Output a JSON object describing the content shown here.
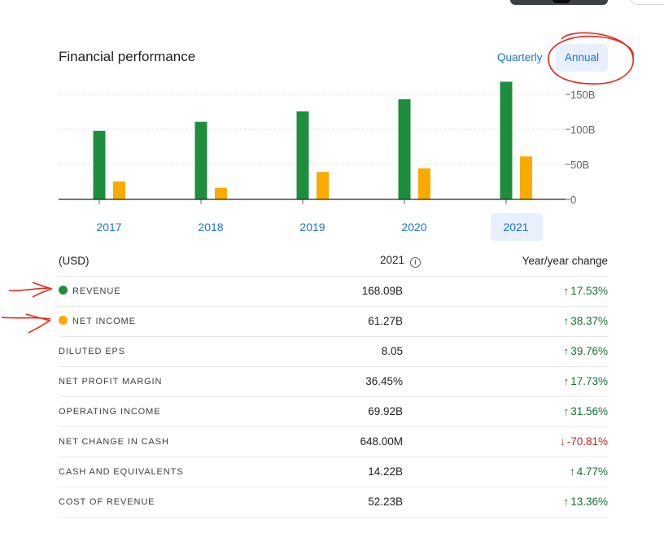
{
  "header": {
    "title": "Financial performance",
    "toggle_quarterly": "Quarterly",
    "toggle_annual": "Annual"
  },
  "colors": {
    "revenue": "#1e8e3e",
    "net_income": "#f9ab00",
    "accent": "#1a73e8",
    "positive": "#137333",
    "negative": "#c5221f"
  },
  "chart_data": {
    "type": "bar",
    "categories": [
      "2017",
      "2018",
      "2019",
      "2020",
      "2021"
    ],
    "series": [
      {
        "name": "Revenue",
        "values": [
          97.9,
          110.8,
          125.8,
          143.0,
          168.1
        ]
      },
      {
        "name": "Net income",
        "values": [
          25.5,
          16.6,
          39.2,
          44.3,
          61.3
        ]
      }
    ],
    "yticks": [
      "0",
      "50B",
      "100B",
      "150B"
    ],
    "ytick_values": [
      0,
      50,
      100,
      150
    ],
    "ylim": [
      0,
      150
    ],
    "selected_category": "2021",
    "grid": true
  },
  "table": {
    "header": {
      "label": "(USD)",
      "year": "2021",
      "change": "Year/year change"
    },
    "rows": [
      {
        "label": "Revenue",
        "value": "168.09B",
        "change": "17.53%",
        "arrow": "↑",
        "dir": "up",
        "dot": "revenue"
      },
      {
        "label": "Net income",
        "value": "61.27B",
        "change": "38.37%",
        "arrow": "↑",
        "dir": "up",
        "dot": "net_income"
      },
      {
        "label": "Diluted EPS",
        "value": "8.05",
        "change": "39.76%",
        "arrow": "↑",
        "dir": "up"
      },
      {
        "label": "Net profit margin",
        "value": "36.45%",
        "change": "17.73%",
        "arrow": "↑",
        "dir": "up"
      },
      {
        "label": "Operating income",
        "value": "69.92B",
        "change": "31.56%",
        "arrow": "↑",
        "dir": "up"
      },
      {
        "label": "Net change in cash",
        "value": "648.00M",
        "change": "-70.81%",
        "arrow": "↓",
        "dir": "down"
      },
      {
        "label": "Cash and equivalents",
        "value": "14.22B",
        "change": "4.77%",
        "arrow": "↑",
        "dir": "up"
      },
      {
        "label": "Cost of revenue",
        "value": "52.23B",
        "change": "13.36%",
        "arrow": "↑",
        "dir": "up"
      }
    ]
  }
}
